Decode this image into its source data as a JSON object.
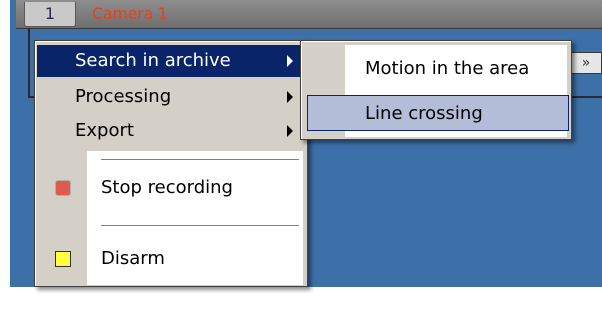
{
  "camera": {
    "number": "1",
    "name": "Camera 1",
    "name_color": "#e1431a"
  },
  "panel": {
    "button_label": "»"
  },
  "context_menu": {
    "items": [
      {
        "label": "Search in archive",
        "has_submenu": true,
        "highlighted": true
      },
      {
        "label": "Processing",
        "has_submenu": true
      },
      {
        "label": "Export",
        "has_submenu": true
      },
      {
        "label": "Stop recording",
        "icon": "stop-recording-icon",
        "icon_color": "#e05a4e"
      },
      {
        "label": "Disarm",
        "icon": "disarm-icon",
        "icon_color": "#ffff40"
      }
    ]
  },
  "submenu": {
    "items": [
      {
        "label": "Motion in the area"
      },
      {
        "label": "Line crossing",
        "selected": true
      }
    ]
  },
  "colors": {
    "background": "#3d6fa8",
    "menu_face": "#d4d0c8",
    "highlight": "#0a246a",
    "selection": "#b4bdd8"
  }
}
